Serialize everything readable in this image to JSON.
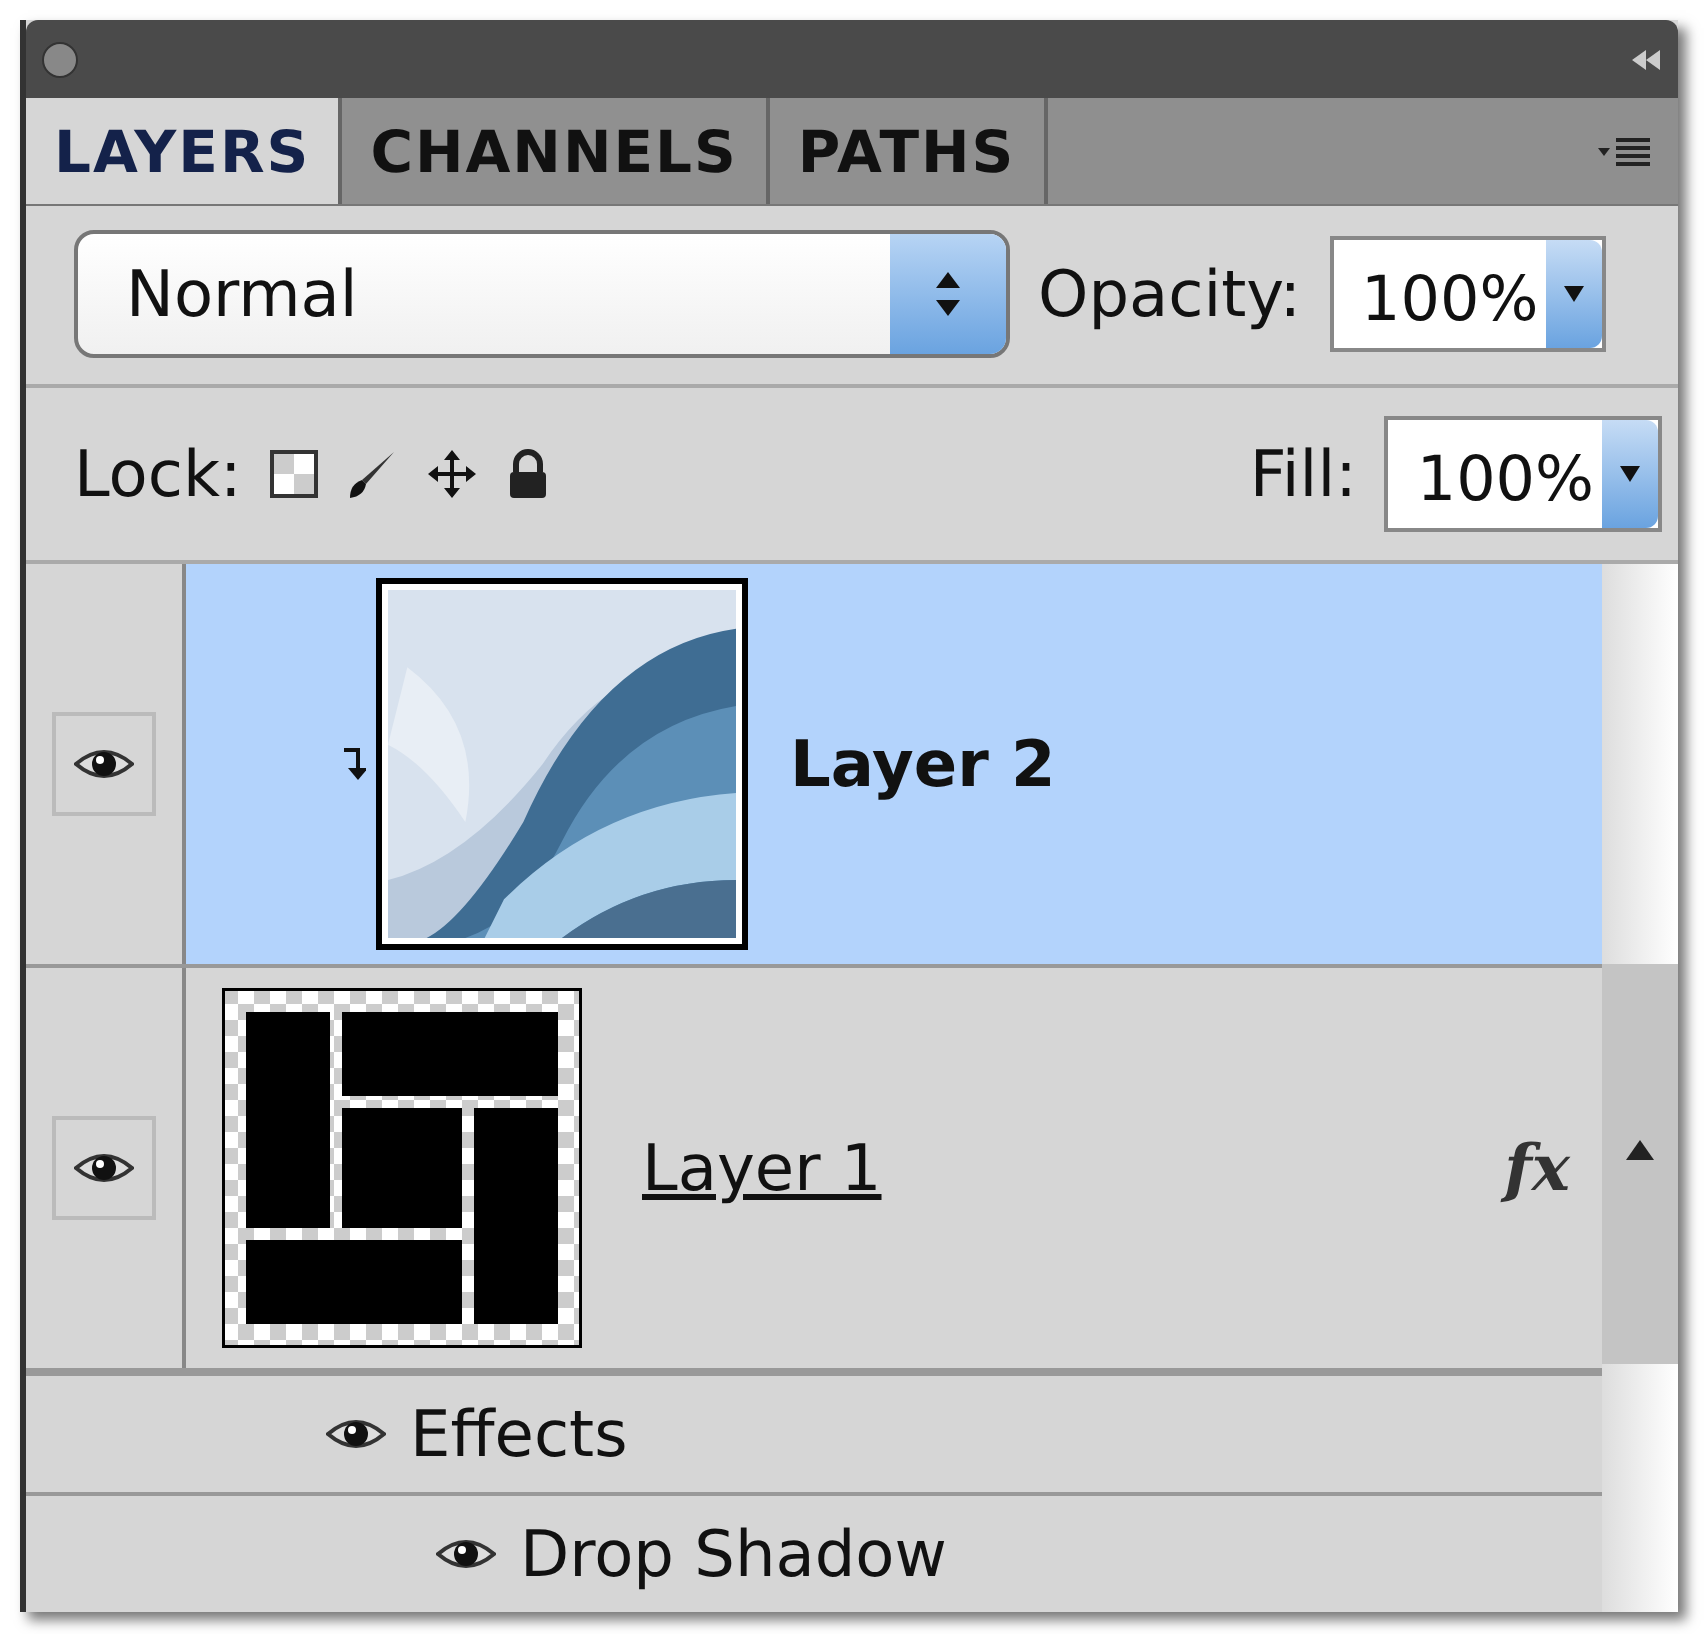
{
  "tabs": [
    {
      "label": "LAYERS",
      "selected": true
    },
    {
      "label": "CHANNELS",
      "selected": false
    },
    {
      "label": "PATHS",
      "selected": false
    }
  ],
  "blend_mode": {
    "value": "Normal"
  },
  "opacity": {
    "label": "Opacity:",
    "value": "100%"
  },
  "lock": {
    "label": "Lock:"
  },
  "fill": {
    "label": "Fill:",
    "value": "100%"
  },
  "layers": [
    {
      "name": "Layer 2",
      "selected": true,
      "visible": true,
      "clipped": true,
      "kind": "picture"
    },
    {
      "name": "Layer 1",
      "selected": false,
      "visible": true,
      "clipped": false,
      "kind": "shapes",
      "fx": "fx",
      "children": [
        {
          "label": "Effects",
          "visible": true,
          "children": [
            {
              "label": "Drop Shadow",
              "visible": true
            }
          ]
        }
      ]
    }
  ]
}
